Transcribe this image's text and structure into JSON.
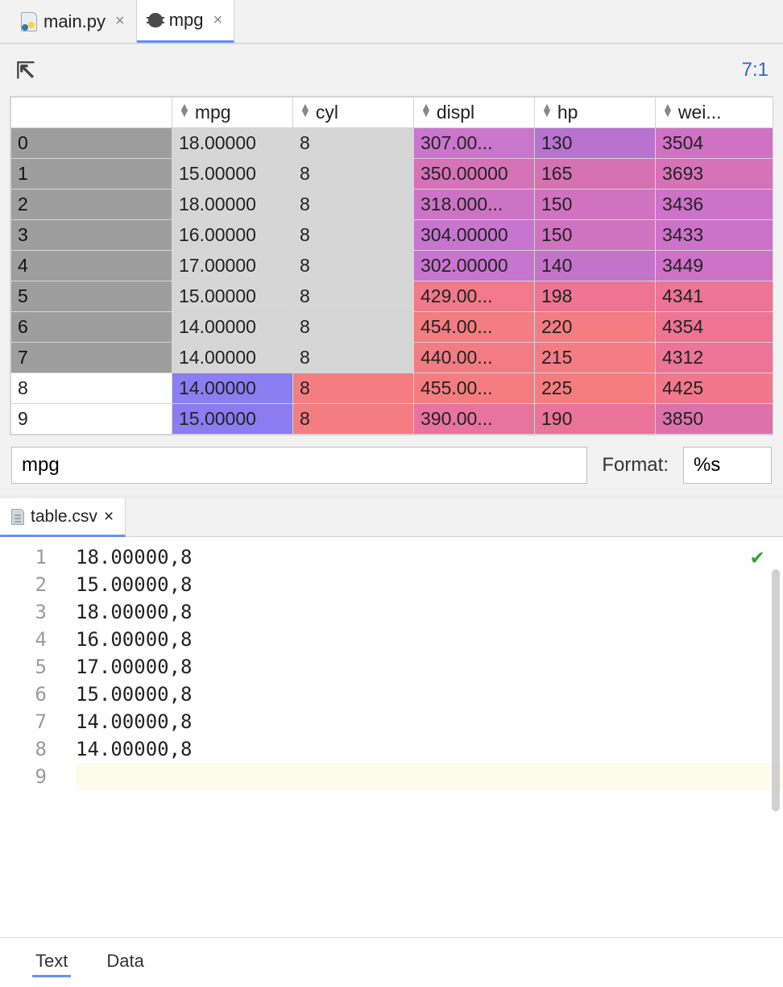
{
  "top_tabs": [
    {
      "label": "main.py",
      "active": false
    },
    {
      "label": "mpg",
      "active": true
    }
  ],
  "cursor_pos": "7:1",
  "columns": [
    "mpg",
    "cyl",
    "displ",
    "hp",
    "wei..."
  ],
  "rows": [
    {
      "idx": "0",
      "sel": true,
      "mpg": "18.00000",
      "cyl": "8",
      "displ": "307.00...",
      "hp": "130",
      "wei": "3504",
      "c_displ": "#c976cc",
      "c_hp": "#b872d0",
      "c_wei": "#cf72c3"
    },
    {
      "idx": "1",
      "sel": true,
      "mpg": "15.00000",
      "cyl": "8",
      "displ": "350.00000",
      "hp": "165",
      "wei": "3693",
      "c_displ": "#d572b8",
      "c_hp": "#d572b2",
      "c_wei": "#d672b8"
    },
    {
      "idx": "2",
      "sel": true,
      "mpg": "18.00000",
      "cyl": "8",
      "displ": "318.000...",
      "hp": "150",
      "wei": "3436",
      "c_displ": "#cd73c5",
      "c_hp": "#cf73c0",
      "c_wei": "#cc72c8"
    },
    {
      "idx": "3",
      "sel": true,
      "mpg": "16.00000",
      "cyl": "8",
      "displ": "304.00000",
      "hp": "150",
      "wei": "3433",
      "c_displ": "#c775ce",
      "c_hp": "#cf73c0",
      "c_wei": "#cc72c8"
    },
    {
      "idx": "4",
      "sel": true,
      "mpg": "17.00000",
      "cyl": "8",
      "displ": "302.00000",
      "hp": "140",
      "wei": "3449",
      "c_displ": "#c775ce",
      "c_hp": "#c374ca",
      "c_wei": "#cd72c6"
    },
    {
      "idx": "5",
      "sel": true,
      "mpg": "15.00000",
      "cyl": "8",
      "displ": "429.00...",
      "hp": "198",
      "wei": "4341",
      "c_displ": "#f07a89",
      "c_hp": "#ed7492",
      "c_wei": "#ec7494"
    },
    {
      "idx": "6",
      "sel": true,
      "mpg": "14.00000",
      "cyl": "8",
      "displ": "454.00...",
      "hp": "220",
      "wei": "4354",
      "c_displ": "#f37d81",
      "c_hp": "#f47c83",
      "c_wei": "#ed7493"
    },
    {
      "idx": "7",
      "sel": true,
      "mpg": "14.00000",
      "cyl": "8",
      "displ": "440.00...",
      "hp": "215",
      "wei": "4312",
      "c_displ": "#f27c84",
      "c_hp": "#f37c85",
      "c_wei": "#eb7497"
    },
    {
      "idx": "8",
      "sel": false,
      "mpg": "14.00000",
      "cyl": "8",
      "displ": "455.00...",
      "hp": "225",
      "wei": "4425",
      "c_mpg": "#8b7df2",
      "c_cyl": "#f37d81",
      "c_displ": "#f47d80",
      "c_hp": "#f57d80",
      "c_wei": "#f0778c"
    },
    {
      "idx": "9",
      "sel": false,
      "mpg": "15.00000",
      "cyl": "8",
      "displ": "390.00...",
      "hp": "190",
      "wei": "3850",
      "c_mpg": "#8d7bf2",
      "c_cyl": "#f37d81",
      "c_displ": "#e8739c",
      "c_hp": "#e97399",
      "c_wei": "#dd72ab"
    }
  ],
  "var_name": "mpg",
  "format_label": "Format:",
  "format_value": "%s",
  "editor_tab": {
    "label": "table.csv"
  },
  "editor_lines": [
    "18.00000,8",
    "15.00000,8",
    "18.00000,8",
    "16.00000,8",
    "17.00000,8",
    "15.00000,8",
    "14.00000,8",
    "14.00000,8",
    ""
  ],
  "view_tabs": [
    "Text",
    "Data"
  ]
}
